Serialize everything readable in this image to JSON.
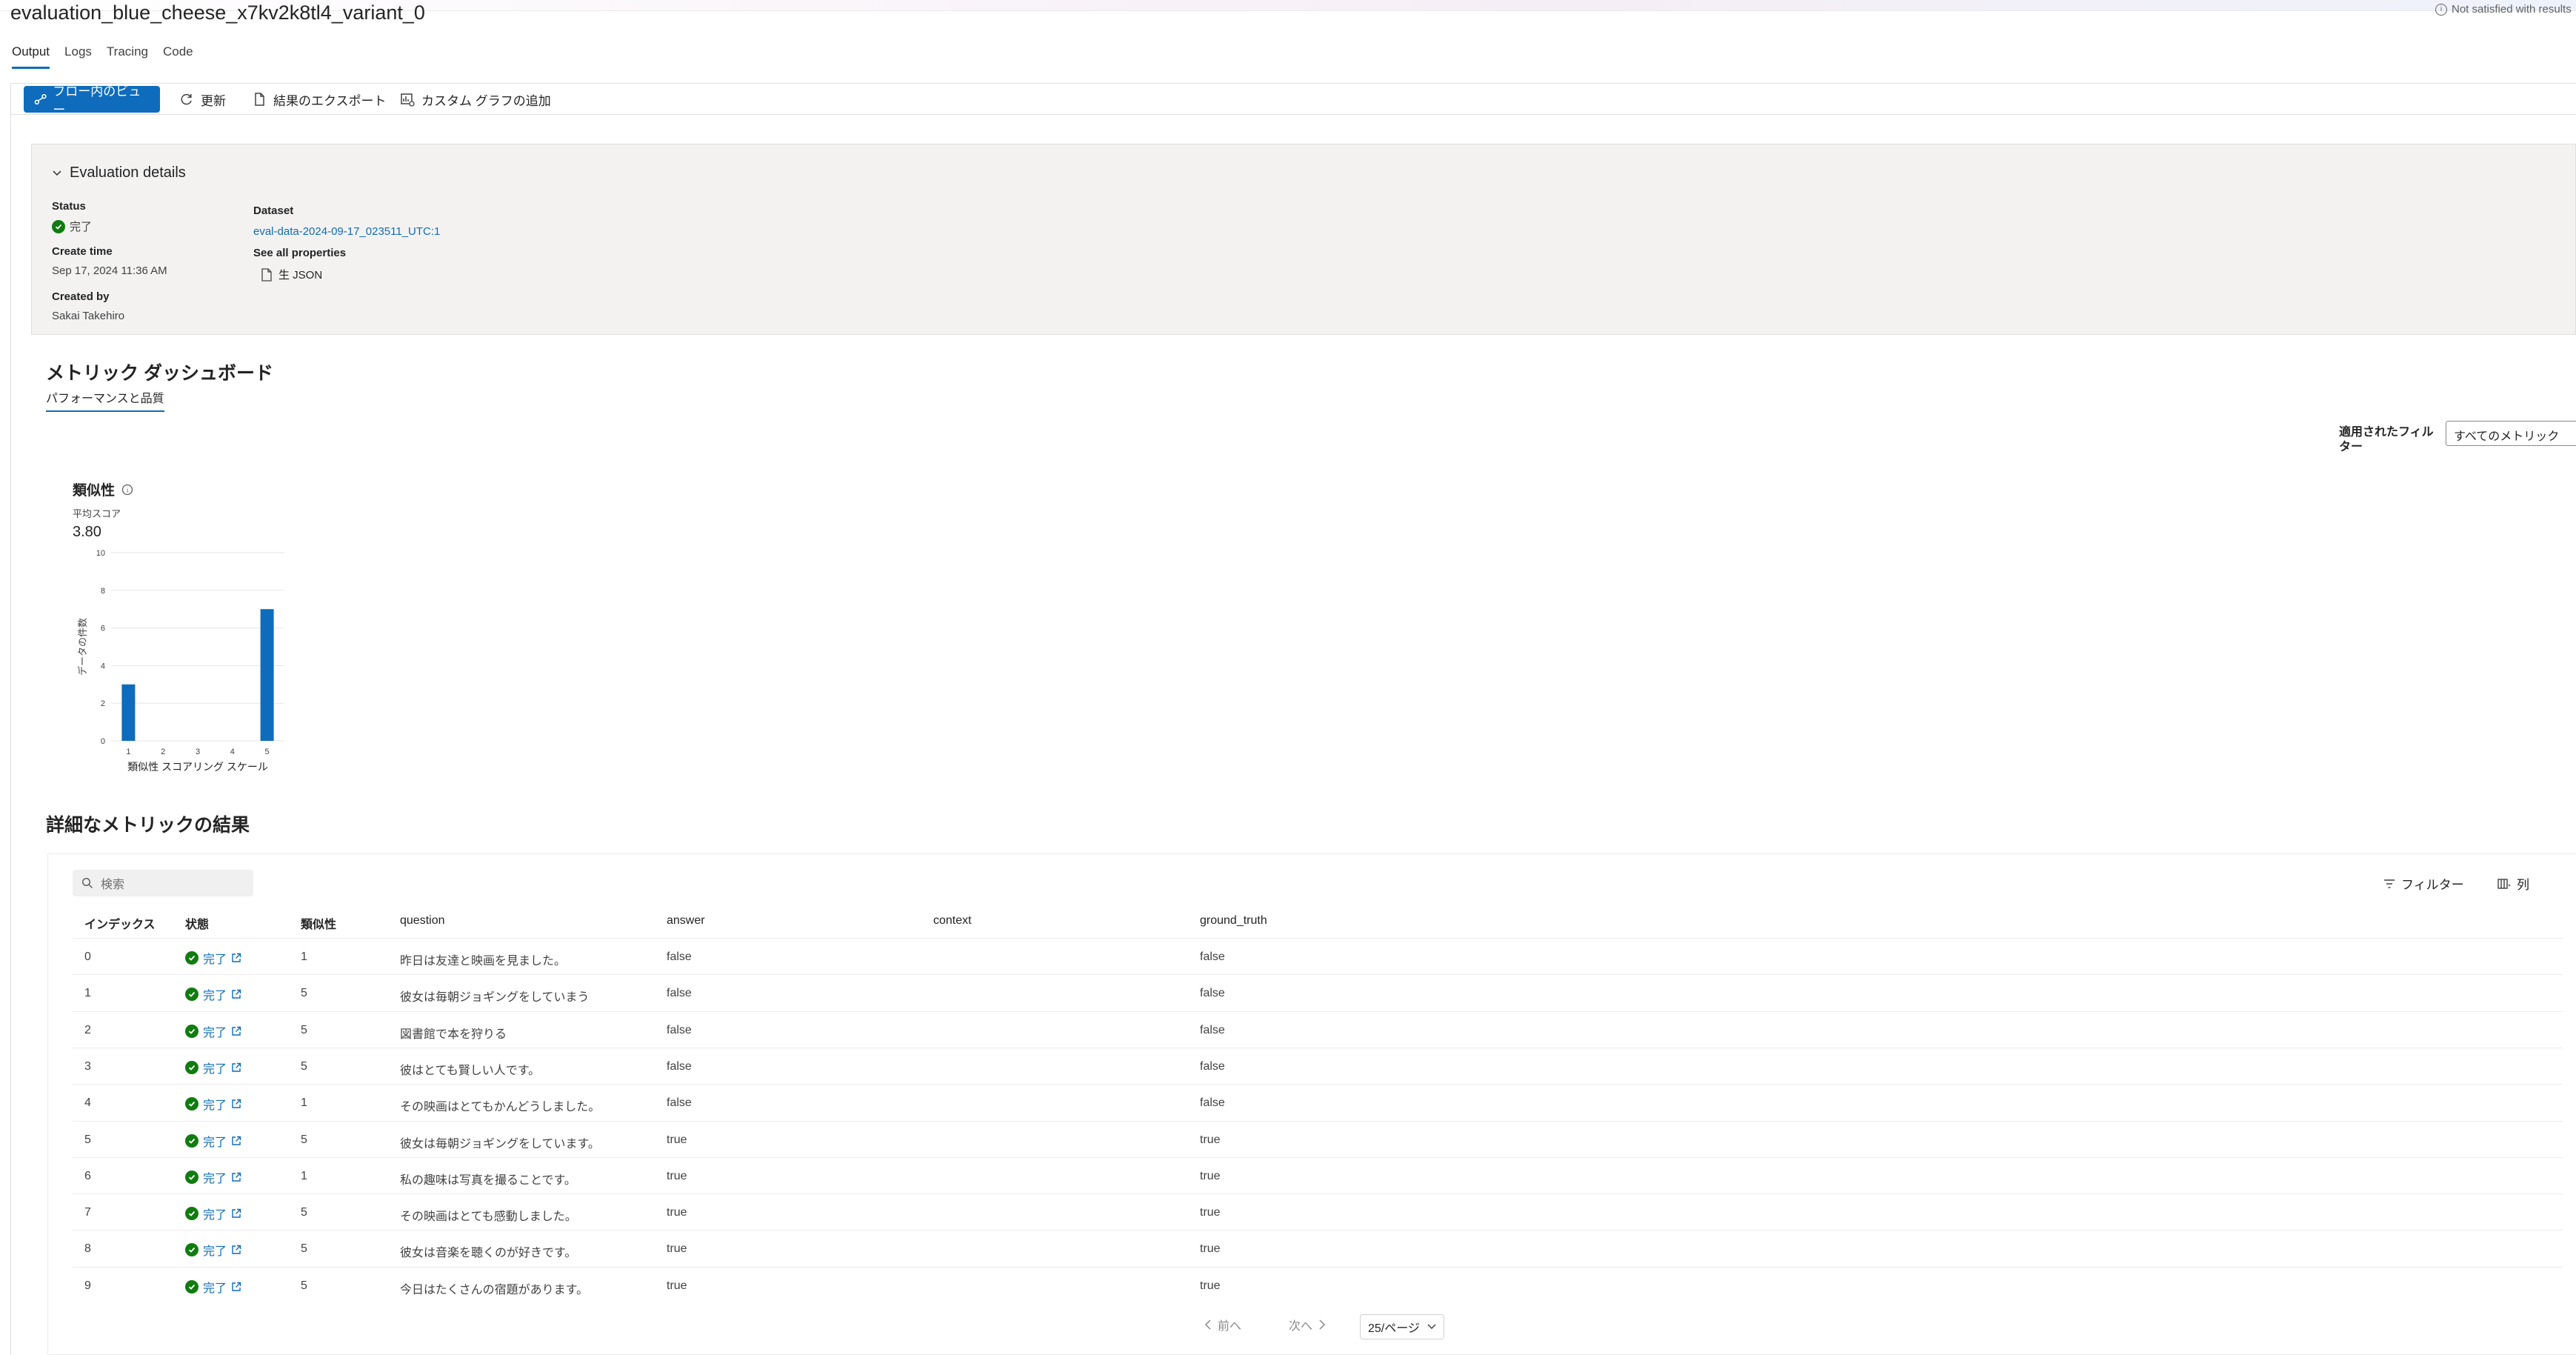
{
  "page": {
    "title": "evaluation_blue_cheese_x7kv2k8tl4_variant_0",
    "notice": "Not satisfied with results"
  },
  "tabs": [
    "Output",
    "Logs",
    "Tracing",
    "Code"
  ],
  "toolbar": {
    "flow_view": "フロー内のビュー",
    "refresh": "更新",
    "export": "結果のエクスポート",
    "add_chart": "カスタム グラフの追加"
  },
  "details": {
    "heading": "Evaluation details",
    "status_label": "Status",
    "status_value": "完了",
    "create_time_label": "Create time",
    "create_time_value": "Sep 17, 2024 11:36 AM",
    "created_by_label": "Created by",
    "created_by_value": "Sakai Takehiro",
    "dataset_label": "Dataset",
    "dataset_value": "eval-data-2024-09-17_023511_UTC:1",
    "properties_label": "See all properties",
    "raw_json": "生 JSON"
  },
  "dashboard": {
    "title": "メトリック ダッシュボード",
    "subtab": "パフォーマンスと品質",
    "filter_label": "適用されたフィルター",
    "filter_value": "すべてのメトリック"
  },
  "chart_data": {
    "type": "bar",
    "title": "類似性",
    "avg_label": "平均スコア",
    "avg_value": "3.80",
    "categories": [
      "1",
      "2",
      "3",
      "4",
      "5"
    ],
    "values": [
      3,
      0,
      0,
      0,
      7
    ],
    "xlabel": "類似性 スコアリング スケール",
    "ylabel": "データの件数",
    "ylim": [
      0,
      10
    ],
    "yticks": [
      "0",
      "2",
      "4",
      "6",
      "8",
      "10"
    ],
    "grid": true,
    "color": "#0f6cbd"
  },
  "results": {
    "title": "詳細なメトリックの結果",
    "search_placeholder": "検索",
    "filter_button": "フィルター",
    "columns_button": "列",
    "headers": [
      "インデックス",
      "状態",
      "類似性",
      "question",
      "answer",
      "context",
      "ground_truth"
    ],
    "rows": [
      {
        "index": "0",
        "status": "完了",
        "similarity": "1",
        "question": "昨日は友達と映画を見ました。",
        "answer": "false",
        "context": "",
        "ground_truth": "false"
      },
      {
        "index": "1",
        "status": "完了",
        "similarity": "5",
        "question": "彼女は毎朝ジョギングをしていまう",
        "answer": "false",
        "context": "",
        "ground_truth": "false"
      },
      {
        "index": "2",
        "status": "完了",
        "similarity": "5",
        "question": "図書館で本を狩りる",
        "answer": "false",
        "context": "",
        "ground_truth": "false"
      },
      {
        "index": "3",
        "status": "完了",
        "similarity": "5",
        "question": "彼はとても賢しい人です。",
        "answer": "false",
        "context": "",
        "ground_truth": "false"
      },
      {
        "index": "4",
        "status": "完了",
        "similarity": "1",
        "question": "その映画はとてもかんどうしました。",
        "answer": "false",
        "context": "",
        "ground_truth": "false"
      },
      {
        "index": "5",
        "status": "完了",
        "similarity": "5",
        "question": "彼女は毎朝ジョギングをしています。",
        "answer": "true",
        "context": "",
        "ground_truth": "true"
      },
      {
        "index": "6",
        "status": "完了",
        "similarity": "1",
        "question": "私の趣味は写真を撮ることです。",
        "answer": "true",
        "context": "",
        "ground_truth": "true"
      },
      {
        "index": "7",
        "status": "完了",
        "similarity": "5",
        "question": "その映画はとても感動しました。",
        "answer": "true",
        "context": "",
        "ground_truth": "true"
      },
      {
        "index": "8",
        "status": "完了",
        "similarity": "5",
        "question": "彼女は音楽を聴くのが好きです。",
        "answer": "true",
        "context": "",
        "ground_truth": "true"
      },
      {
        "index": "9",
        "status": "完了",
        "similarity": "5",
        "question": "今日はたくさんの宿題があります。",
        "answer": "true",
        "context": "",
        "ground_truth": "true"
      }
    ],
    "pager": {
      "prev": "前へ",
      "next": "次へ",
      "page_size": "25/ページ"
    }
  },
  "icons": {
    "flow": "flow-icon",
    "refresh": "refresh-icon",
    "export": "document-icon",
    "chart": "chart-add-icon",
    "search": "search-icon",
    "filter": "filter-icon",
    "columns": "columns-icon",
    "status_ok": "check-circle-icon",
    "open": "open-external-icon"
  }
}
